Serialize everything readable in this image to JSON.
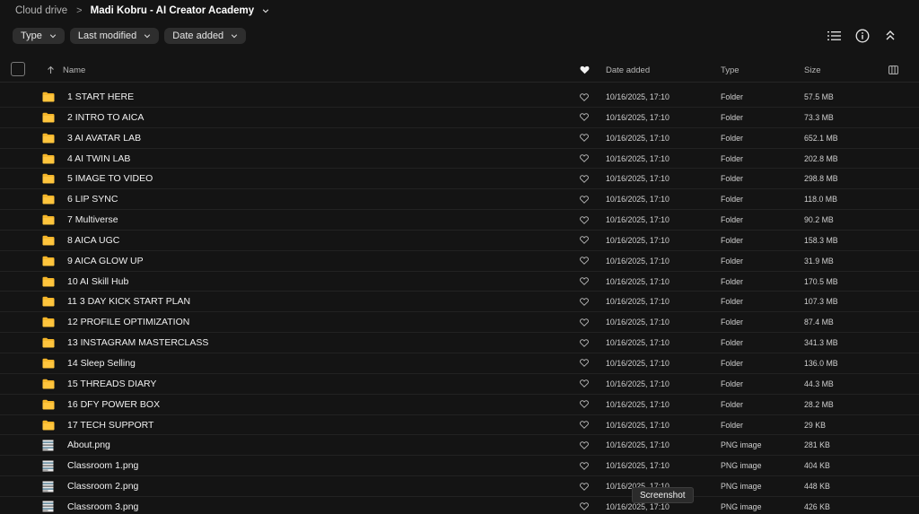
{
  "breadcrumb": {
    "root": "Cloud drive",
    "current": "Madi Kobru - AI Creator Academy"
  },
  "filters": [
    {
      "label": "Type"
    },
    {
      "label": "Last modified"
    },
    {
      "label": "Date added"
    }
  ],
  "toolbar": {
    "icons": [
      "list-view-icon",
      "info-icon",
      "collapse-icon"
    ]
  },
  "columns": {
    "name": "Name",
    "date_added": "Date added",
    "type": "Type",
    "size": "Size"
  },
  "rows": [
    {
      "name": "1 START HERE",
      "date": "10/16/2025, 17:10",
      "type": "Folder",
      "size": "57.5 MB",
      "icon": "folder-icon"
    },
    {
      "name": "2 INTRO TO AICA",
      "date": "10/16/2025, 17:10",
      "type": "Folder",
      "size": "73.3 MB",
      "icon": "folder-icon"
    },
    {
      "name": "3 AI AVATAR LAB",
      "date": "10/16/2025, 17:10",
      "type": "Folder",
      "size": "652.1 MB",
      "icon": "folder-icon"
    },
    {
      "name": "4 AI TWIN LAB",
      "date": "10/16/2025, 17:10",
      "type": "Folder",
      "size": "202.8 MB",
      "icon": "folder-icon"
    },
    {
      "name": "5 IMAGE TO VIDEO",
      "date": "10/16/2025, 17:10",
      "type": "Folder",
      "size": "298.8 MB",
      "icon": "folder-icon"
    },
    {
      "name": "6 LIP SYNC",
      "date": "10/16/2025, 17:10",
      "type": "Folder",
      "size": "118.0 MB",
      "icon": "folder-icon"
    },
    {
      "name": "7 Multiverse",
      "date": "10/16/2025, 17:10",
      "type": "Folder",
      "size": "90.2 MB",
      "icon": "folder-icon"
    },
    {
      "name": "8 AICA UGC",
      "date": "10/16/2025, 17:10",
      "type": "Folder",
      "size": "158.3 MB",
      "icon": "folder-icon"
    },
    {
      "name": "9 AICA GLOW UP",
      "date": "10/16/2025, 17:10",
      "type": "Folder",
      "size": "31.9 MB",
      "icon": "folder-icon"
    },
    {
      "name": "10 AI Skill Hub",
      "date": "10/16/2025, 17:10",
      "type": "Folder",
      "size": "170.5 MB",
      "icon": "folder-icon"
    },
    {
      "name": "11 3 DAY KICK START PLAN",
      "date": "10/16/2025, 17:10",
      "type": "Folder",
      "size": "107.3 MB",
      "icon": "folder-icon"
    },
    {
      "name": "12 PROFILE OPTIMIZATION",
      "date": "10/16/2025, 17:10",
      "type": "Folder",
      "size": "87.4 MB",
      "icon": "folder-icon"
    },
    {
      "name": "13 INSTAGRAM MASTERCLASS",
      "date": "10/16/2025, 17:10",
      "type": "Folder",
      "size": "341.3 MB",
      "icon": "folder-icon"
    },
    {
      "name": "14 Sleep Selling",
      "date": "10/16/2025, 17:10",
      "type": "Folder",
      "size": "136.0 MB",
      "icon": "folder-icon"
    },
    {
      "name": "15 THREADS DIARY",
      "date": "10/16/2025, 17:10",
      "type": "Folder",
      "size": "44.3 MB",
      "icon": "folder-icon"
    },
    {
      "name": "16 DFY POWER BOX",
      "date": "10/16/2025, 17:10",
      "type": "Folder",
      "size": "28.2 MB",
      "icon": "folder-icon"
    },
    {
      "name": "17 TECH SUPPORT",
      "date": "10/16/2025, 17:10",
      "type": "Folder",
      "size": "29 KB",
      "icon": "folder-icon"
    },
    {
      "name": "About.png",
      "date": "10/16/2025, 17:10",
      "type": "PNG image",
      "size": "281 KB",
      "icon": "image-thumbnail-icon"
    },
    {
      "name": "Classroom 1.png",
      "date": "10/16/2025, 17:10",
      "type": "PNG image",
      "size": "404 KB",
      "icon": "image-thumbnail-icon"
    },
    {
      "name": "Classroom 2.png",
      "date": "10/16/2025, 17:10",
      "type": "PNG image",
      "size": "448 KB",
      "icon": "image-thumbnail-icon"
    },
    {
      "name": "Classroom 3.png",
      "date": "10/16/2025, 17:10",
      "type": "PNG image",
      "size": "426 KB",
      "icon": "image-thumbnail-icon"
    }
  ],
  "tooltip": {
    "text": "Screenshot"
  },
  "colors": {
    "background": "#141414",
    "folder": "#f5b62a",
    "chip": "#2e2e2e",
    "text": "#e8e8e8"
  }
}
